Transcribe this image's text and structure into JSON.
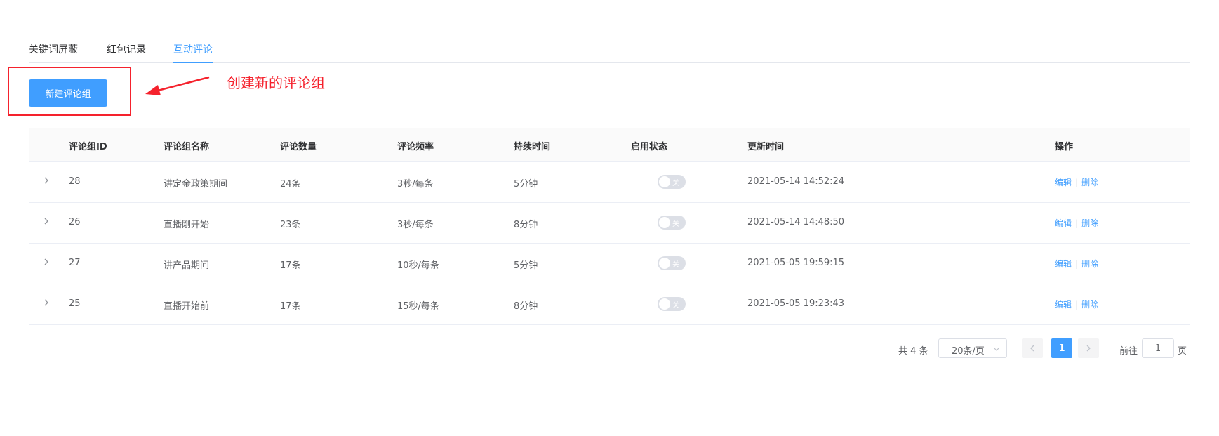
{
  "tabs": [
    {
      "label": "关键词屏蔽",
      "active": false
    },
    {
      "label": "红包记录",
      "active": false
    },
    {
      "label": "互动评论",
      "active": true
    }
  ],
  "toolbar": {
    "create_label": "新建评论组",
    "annotation": "创建新的评论组"
  },
  "table": {
    "headers": [
      "评论组ID",
      "评论组名称",
      "评论数量",
      "评论频率",
      "持续时间",
      "启用状态",
      "更新时间",
      "操作"
    ],
    "rows": [
      {
        "id": "28",
        "name": "讲定金政策期间",
        "count": "24条",
        "freq": "3秒/每条",
        "duration": "5分钟",
        "status_label": "关",
        "updated": "2021-05-14 14:52:24"
      },
      {
        "id": "26",
        "name": "直播刚开始",
        "count": "23条",
        "freq": "3秒/每条",
        "duration": "8分钟",
        "status_label": "关",
        "updated": "2021-05-14 14:48:50"
      },
      {
        "id": "27",
        "name": "讲产品期间",
        "count": "17条",
        "freq": "10秒/每条",
        "duration": "5分钟",
        "status_label": "关",
        "updated": "2021-05-05 19:59:15"
      },
      {
        "id": "25",
        "name": "直播开始前",
        "count": "17条",
        "freq": "15秒/每条",
        "duration": "8分钟",
        "status_label": "关",
        "updated": "2021-05-05 19:23:43"
      }
    ],
    "edit_label": "编辑",
    "delete_label": "删除"
  },
  "pagination": {
    "total": "共 4 条",
    "page_size": "20条/页",
    "current_page": "1",
    "goto_prefix": "前往",
    "goto_value": "1",
    "goto_suffix": "页"
  },
  "colors": {
    "primary": "#409eff",
    "annotation": "#f5222d",
    "switch_off": "#dcdfe6"
  }
}
